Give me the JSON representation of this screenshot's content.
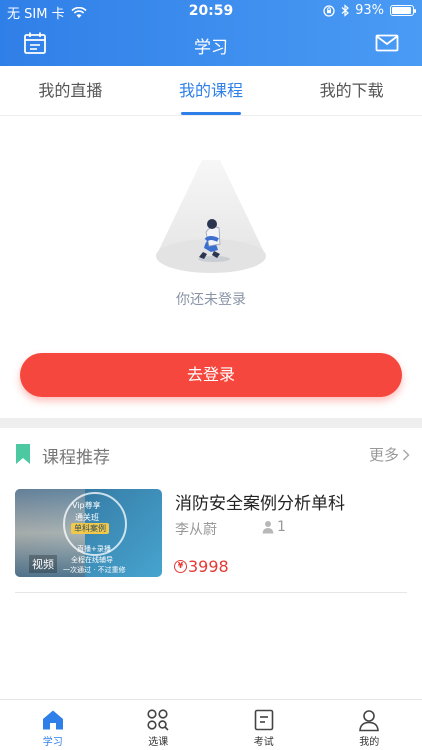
{
  "status_bar": {
    "carrier": "无 SIM 卡",
    "time": "20:59",
    "battery": "93%",
    "battery_level": 0.93
  },
  "nav": {
    "title": "学习",
    "left_icon": "calendar-icon",
    "right_icon": "mail-icon"
  },
  "tabs": [
    {
      "label": "我的直播",
      "active": false
    },
    {
      "label": "我的课程",
      "active": true
    },
    {
      "label": "我的下载",
      "active": false
    }
  ],
  "empty_state": {
    "message": "你还未登录"
  },
  "login_button": {
    "label": "去登录",
    "color": "#f5473d"
  },
  "recommend": {
    "title": "课程推荐",
    "more_label": "更多",
    "accent": "#4cc9a0",
    "courses": [
      {
        "title": "消防安全案例分析单科",
        "teacher": "李从蔚",
        "students": "1",
        "price": "3998",
        "thumb": {
          "line1": "Vip尊享",
          "line2": "通关班",
          "line3": "单科案例",
          "line4": "直播+录播",
          "line5": "全程在线辅导",
          "line6": "一次通过 · 不过重修",
          "tag": "视频"
        }
      }
    ]
  },
  "tabbar": {
    "items": [
      {
        "label": "学习",
        "icon": "home-icon",
        "active": true
      },
      {
        "label": "选课",
        "icon": "grid-search-icon",
        "active": false
      },
      {
        "label": "考试",
        "icon": "exam-icon",
        "active": false
      },
      {
        "label": "我的",
        "icon": "profile-icon",
        "active": false
      }
    ]
  },
  "colors": {
    "primary": "#2f7fe8",
    "price": "#e53935"
  }
}
